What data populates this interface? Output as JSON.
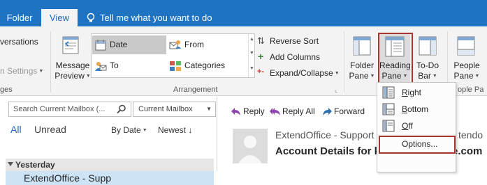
{
  "tabs": {
    "folder": "Folder",
    "view": "View",
    "tell_me": "Tell me what you want to do"
  },
  "ribbon": {
    "conversations_label": "versations",
    "conversation_settings_label": "n Settings",
    "partial_group_label": "ges",
    "message_preview": {
      "line1": "Message",
      "line2": "Preview"
    },
    "arrangement": {
      "items": [
        {
          "label": "Date",
          "selected": true
        },
        {
          "label": "From",
          "selected": false
        },
        {
          "label": "To",
          "selected": false
        },
        {
          "label": "Categories",
          "selected": false
        }
      ],
      "reverse_sort": "Reverse Sort",
      "add_columns": "Add Columns",
      "expand_collapse": "Expand/Collapse",
      "group_label": "Arrangement"
    },
    "folder_pane": {
      "line1": "Folder",
      "line2": "Pane"
    },
    "reading_pane": {
      "line1": "Reading",
      "line2": "Pane"
    },
    "todo_bar": {
      "line1": "To-Do",
      "line2": "Bar"
    },
    "people_pane": {
      "line1": "People",
      "line2": "Pane"
    },
    "people_group_partial": "ople Pa"
  },
  "reading_pane_menu": {
    "items": [
      "Right",
      "Bottom",
      "Off"
    ],
    "options": "Options..."
  },
  "mail_list": {
    "search_placeholder": "Search Current Mailbox (...",
    "scope": "Current Mailbox",
    "filter_all": "All",
    "filter_unread": "Unread",
    "sort_by": "By Date",
    "sort_order": "Newest",
    "group_header": "Yesterday",
    "first_item_sender": "ExtendOffice - Supp"
  },
  "reading": {
    "reply": "Reply",
    "reply_all": "Reply All",
    "forward": "Forward",
    "sender": "ExtendOffice - Support",
    "sender_tail": "tendo",
    "subject": "Account Details for ke",
    "subject_tail": "e.com"
  },
  "colors": {
    "accent_blue": "#1e73c3",
    "highlight_red": "#a6362f",
    "ribbon_bg": "#f3f3f3"
  }
}
